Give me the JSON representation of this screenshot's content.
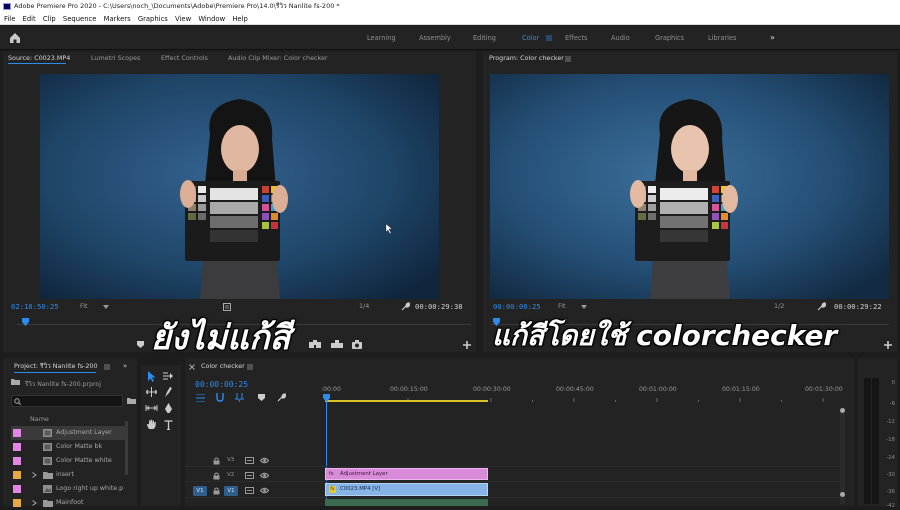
{
  "window": {
    "title": "Adobe Premiere Pro 2020 - C:\\Users\\noch_\\Documents\\Adobe\\Premiere Pro\\14.0\\รีวิว Nanlite fs-200 *"
  },
  "menu": [
    "File",
    "Edit",
    "Clip",
    "Sequence",
    "Markers",
    "Graphics",
    "View",
    "Window",
    "Help"
  ],
  "workspaces": [
    "Learning",
    "Assembly",
    "Editing",
    "Color",
    "Effects",
    "Audio",
    "Graphics",
    "Libraries"
  ],
  "workspace_active": "Color",
  "workspace_more": "»",
  "source_panel": {
    "tabs": [
      "Source: C0023.MP4",
      "Lumetri Scopes",
      "Effect Controls",
      "Audio Clip Mixer: Color checker"
    ],
    "timecode": "02:18:50:25",
    "fit": "Fit",
    "resolution": "1/4",
    "duration": "00:00:29:38",
    "overlay_text": "ยังไม่แก้สี"
  },
  "program_panel": {
    "tab": "Program: Color checker",
    "timecode": "00:00:00:25",
    "fit": "Fit",
    "resolution": "1/2",
    "duration": "00:00:29:22",
    "overlay_text": "แก้สีโดยใช้ colorchecker"
  },
  "project_panel": {
    "tab": "Project: รีวิว Nanlite fs-200",
    "project_file": "รีวิว Nanlite fs-200.prproj",
    "column_name": "Name",
    "items": [
      {
        "name": "Adjustment Layer",
        "color": "#e487e4",
        "type": "clip"
      },
      {
        "name": "Color Matte bk",
        "color": "#e487e4",
        "type": "clip"
      },
      {
        "name": "Color Matte white",
        "color": "#e487e4",
        "type": "clip"
      },
      {
        "name": "insert",
        "color": "#e8a844",
        "type": "folder"
      },
      {
        "name": "Logo right up white.p",
        "color": "#e487e4",
        "type": "clip"
      },
      {
        "name": "Mainfoot",
        "color": "#e8a844",
        "type": "folder"
      }
    ]
  },
  "timeline": {
    "tab": "Color checker",
    "timecode": "00:00:00:25",
    "ruler": [
      ":00:00",
      "00:00:15:00",
      "00:00:30:00",
      "00:00:45:00",
      "00:01:00:00",
      "00:01:15:00",
      "00:01:30:00"
    ],
    "tracks": [
      "V3",
      "V2",
      "V1"
    ],
    "source_patch": "V1",
    "clips": [
      {
        "track": "V2",
        "label": "Adjustment Layer",
        "color": "#d88bd8"
      },
      {
        "track": "V1",
        "label": "C0023.MP4 [V]",
        "color": "#86b4e6"
      }
    ]
  },
  "meter": {
    "labels": [
      "0",
      "-6",
      "-12",
      "-18",
      "-24",
      "-30",
      "-36",
      "-42"
    ]
  },
  "colors": {
    "accent_blue": "#2d8ceb",
    "background": "#232323",
    "video_blue": "#1b3a5c"
  }
}
